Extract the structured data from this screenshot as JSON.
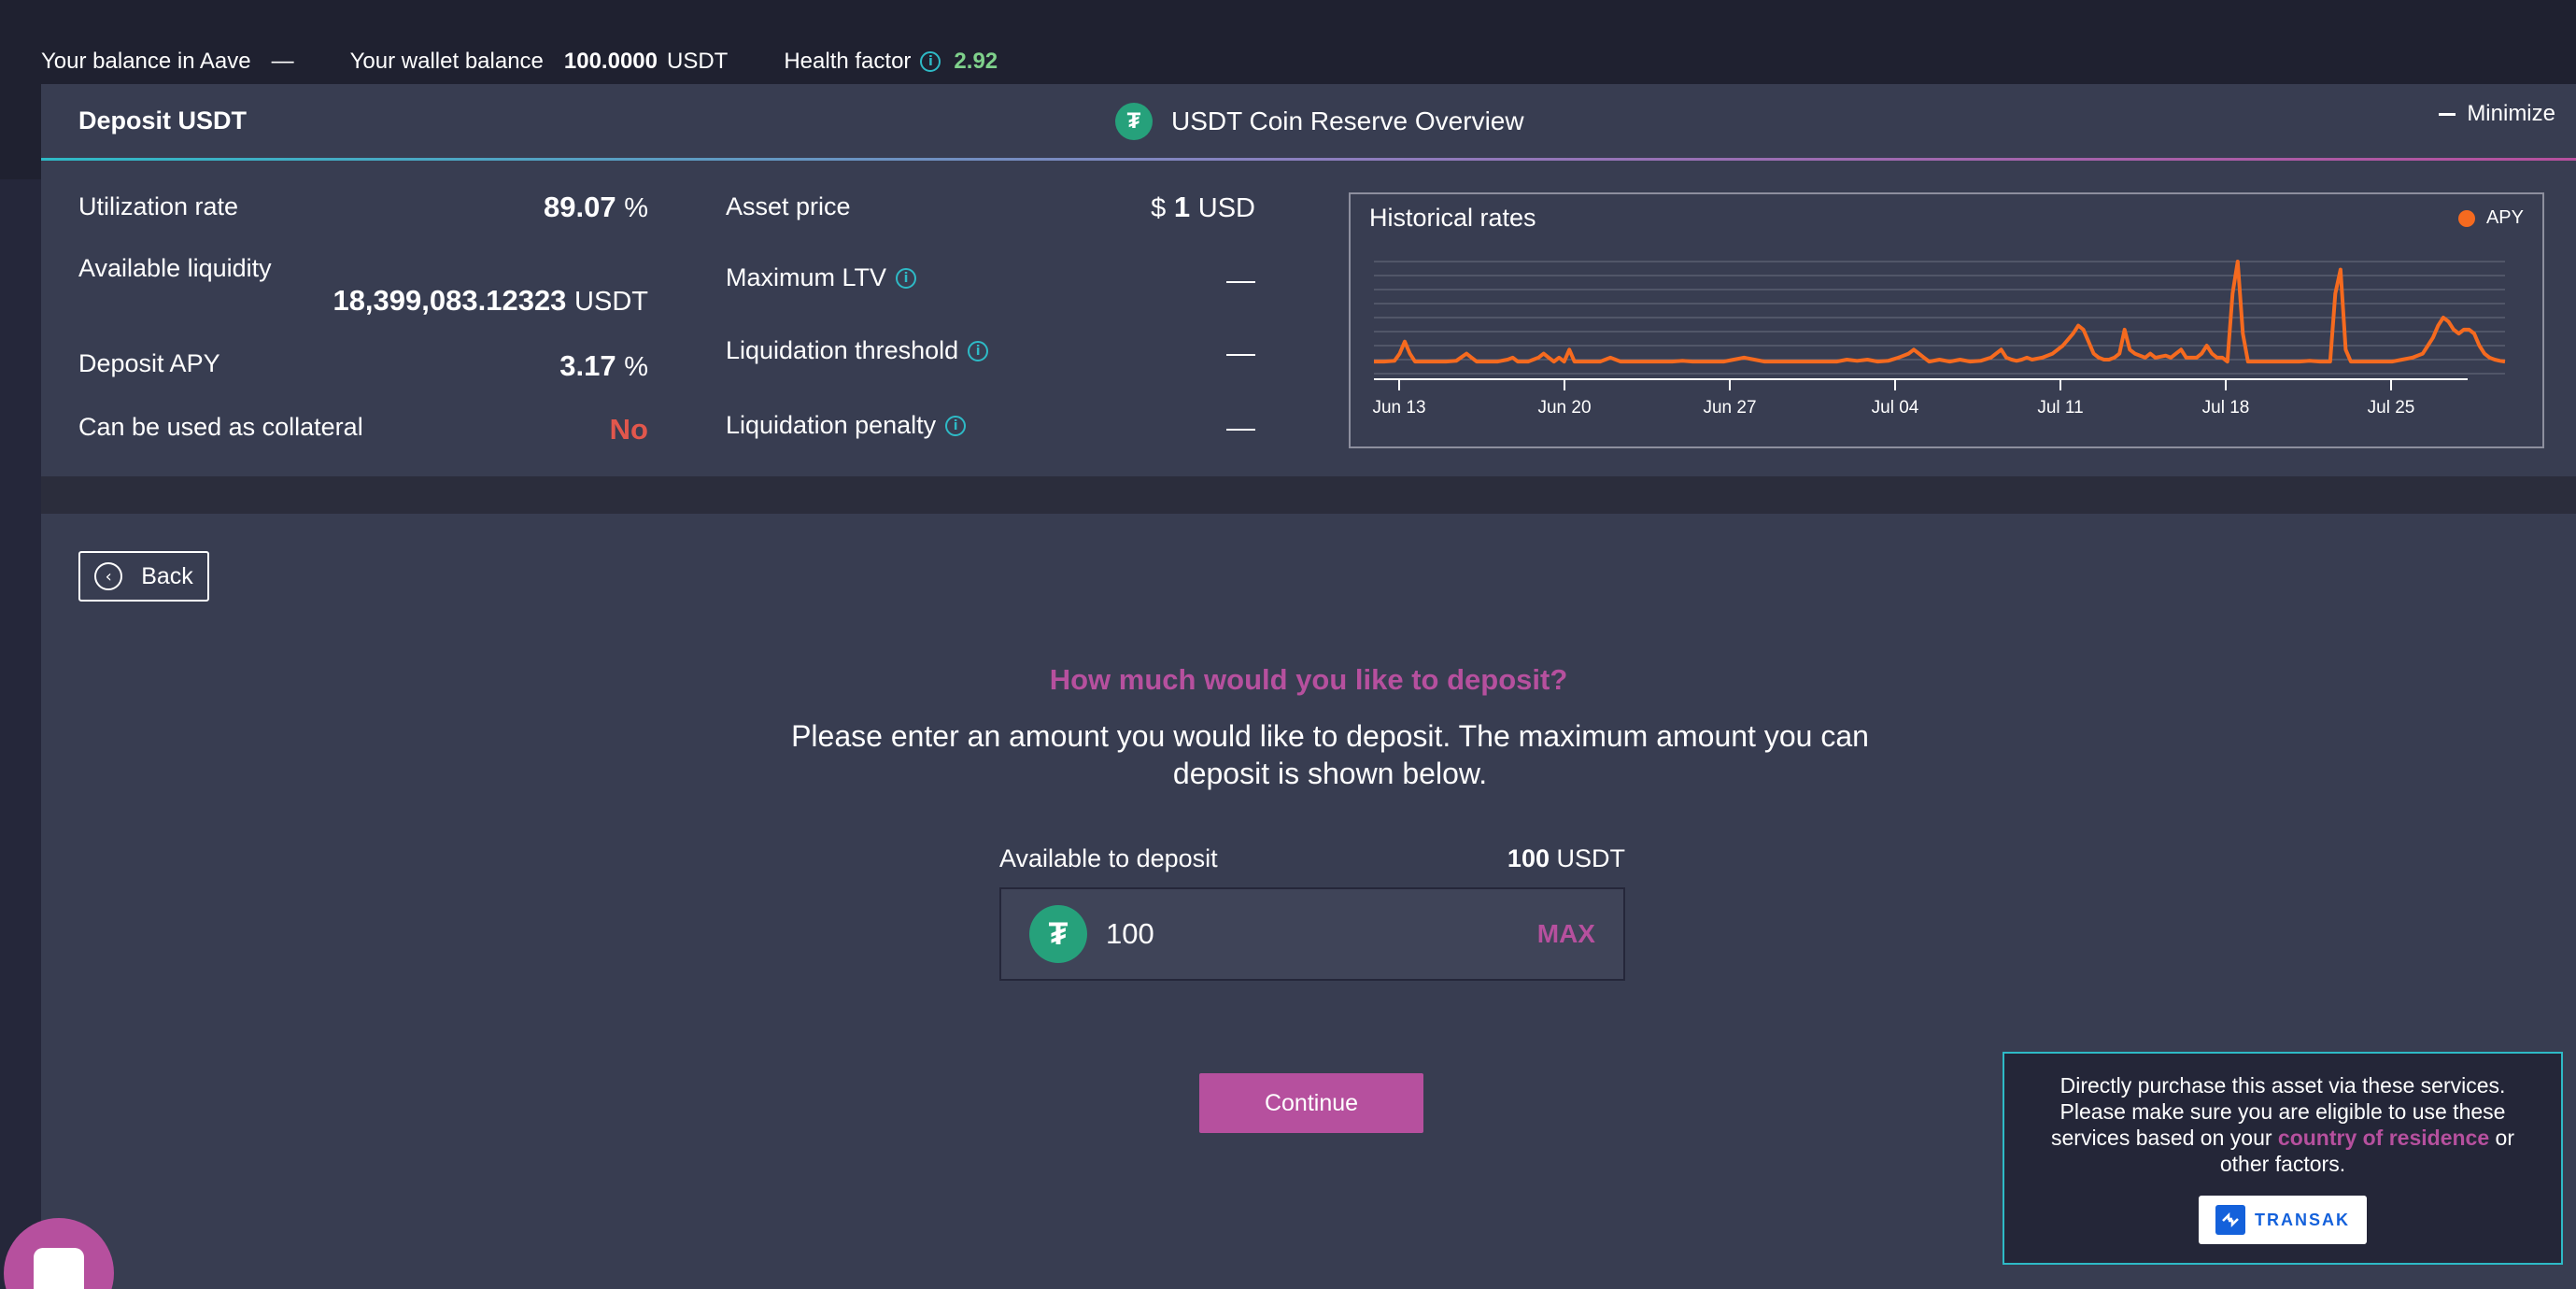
{
  "topbar": {
    "balance_aave_label": "Your balance in Aave",
    "balance_aave_value": "—",
    "wallet_label": "Your wallet balance",
    "wallet_value": "100.0000",
    "wallet_unit": "USDT",
    "health_label": "Health factor",
    "health_value": "2.92"
  },
  "overview": {
    "deposit_title": "Deposit USDT",
    "reserve_title": "USDT Coin Reserve Overview",
    "minimize_label": "Minimize",
    "stats_left": [
      {
        "label": "Utilization rate",
        "value": "89.07",
        "unit": "%"
      },
      {
        "label": "Available liquidity",
        "value": "18,399,083.12323",
        "unit": "USDT"
      },
      {
        "label": "Deposit APY",
        "value": "3.17",
        "unit": "%"
      },
      {
        "label": "Can be used as collateral",
        "value": "No"
      }
    ],
    "stats_mid": [
      {
        "label": "Asset price",
        "prefix": "$",
        "value": "1",
        "unit": "USD"
      },
      {
        "label": "Maximum LTV",
        "value": "—"
      },
      {
        "label": "Liquidation threshold",
        "value": "—"
      },
      {
        "label": "Liquidation penalty",
        "value": "—"
      }
    ]
  },
  "chart_data": {
    "type": "line",
    "title": "Historical rates",
    "legend": "APY",
    "legend_position": "top-right",
    "color": "#f56a1f",
    "grid": true,
    "x_ticks": [
      "Jun 13",
      "Jun 20",
      "Jun 27",
      "Jul 04",
      "Jul 11",
      "Jul 18",
      "Jul 25"
    ],
    "series": [
      {
        "name": "APY",
        "points": [
          [
            0,
            3
          ],
          [
            2,
            3
          ],
          [
            4,
            3.2
          ],
          [
            5,
            5
          ],
          [
            6,
            8
          ],
          [
            7,
            5
          ],
          [
            8,
            3
          ],
          [
            10,
            3
          ],
          [
            12,
            3
          ],
          [
            14,
            3
          ],
          [
            16,
            3.2
          ],
          [
            18,
            5
          ],
          [
            19,
            4
          ],
          [
            20,
            3
          ],
          [
            22,
            3
          ],
          [
            24,
            3
          ],
          [
            26,
            3.5
          ],
          [
            27,
            4
          ],
          [
            28,
            3
          ],
          [
            30,
            3
          ],
          [
            32,
            4
          ],
          [
            33,
            5
          ],
          [
            34,
            4
          ],
          [
            35,
            3
          ],
          [
            36,
            4
          ],
          [
            37,
            3
          ],
          [
            38,
            6
          ],
          [
            39,
            3
          ],
          [
            40,
            3
          ],
          [
            44,
            3
          ],
          [
            46,
            4
          ],
          [
            48,
            3
          ],
          [
            50,
            3
          ],
          [
            52,
            3
          ],
          [
            54,
            3
          ],
          [
            56,
            3
          ],
          [
            58,
            3
          ],
          [
            60,
            3.2
          ],
          [
            62,
            3
          ],
          [
            64,
            3
          ],
          [
            66,
            3
          ],
          [
            68,
            3
          ],
          [
            70,
            3.5
          ],
          [
            72,
            4
          ],
          [
            74,
            3.5
          ],
          [
            76,
            3
          ],
          [
            78,
            3
          ],
          [
            80,
            3
          ],
          [
            82,
            3
          ],
          [
            84,
            3
          ],
          [
            86,
            3
          ],
          [
            88,
            3
          ],
          [
            90,
            3
          ],
          [
            92,
            3.5
          ],
          [
            94,
            3.2
          ],
          [
            96,
            3.5
          ],
          [
            98,
            3
          ],
          [
            100,
            3.2
          ],
          [
            102,
            4
          ],
          [
            104,
            5
          ],
          [
            105,
            6
          ],
          [
            106,
            5
          ],
          [
            107,
            4
          ],
          [
            108,
            3
          ],
          [
            110,
            3.5
          ],
          [
            112,
            3
          ],
          [
            114,
            3.5
          ],
          [
            116,
            3
          ],
          [
            118,
            3.2
          ],
          [
            120,
            4
          ],
          [
            121,
            5
          ],
          [
            122,
            6
          ],
          [
            123,
            4
          ],
          [
            124,
            3.5
          ],
          [
            125,
            3.2
          ],
          [
            126,
            3.5
          ],
          [
            127,
            4
          ],
          [
            128,
            3.5
          ],
          [
            130,
            4
          ],
          [
            132,
            5
          ],
          [
            134,
            7
          ],
          [
            136,
            10
          ],
          [
            137,
            12
          ],
          [
            138,
            11
          ],
          [
            139,
            8
          ],
          [
            140,
            5
          ],
          [
            141,
            4
          ],
          [
            142,
            3.5
          ],
          [
            143,
            3.5
          ],
          [
            144,
            4
          ],
          [
            145,
            5
          ],
          [
            146,
            11
          ],
          [
            147,
            6
          ],
          [
            148,
            5
          ],
          [
            149,
            4.5
          ],
          [
            150,
            4
          ],
          [
            151,
            5
          ],
          [
            152,
            4
          ],
          [
            154,
            4.5
          ],
          [
            155,
            4
          ],
          [
            156,
            5
          ],
          [
            157,
            6
          ],
          [
            158,
            4
          ],
          [
            159,
            4
          ],
          [
            160,
            4
          ],
          [
            161,
            5
          ],
          [
            162,
            7
          ],
          [
            163,
            5
          ],
          [
            164,
            4
          ],
          [
            165,
            4
          ],
          [
            166,
            3
          ],
          [
            167,
            20
          ],
          [
            168,
            28
          ],
          [
            169,
            10
          ],
          [
            170,
            3
          ],
          [
            172,
            3
          ],
          [
            174,
            3
          ],
          [
            176,
            3
          ],
          [
            178,
            3
          ],
          [
            180,
            3
          ],
          [
            182,
            3.2
          ],
          [
            184,
            3
          ],
          [
            186,
            3
          ],
          [
            187,
            20
          ],
          [
            188,
            26
          ],
          [
            189,
            6
          ],
          [
            190,
            3
          ],
          [
            192,
            3
          ],
          [
            194,
            3
          ],
          [
            196,
            3
          ],
          [
            198,
            3
          ],
          [
            200,
            3.5
          ],
          [
            202,
            4
          ],
          [
            204,
            5
          ],
          [
            205,
            7
          ],
          [
            206,
            9
          ],
          [
            207,
            12
          ],
          [
            208,
            14
          ],
          [
            209,
            13
          ],
          [
            210,
            11
          ],
          [
            211,
            10
          ],
          [
            212,
            11
          ],
          [
            213,
            11
          ],
          [
            214,
            10
          ],
          [
            215,
            7
          ],
          [
            216,
            5
          ],
          [
            217,
            4
          ],
          [
            218,
            3.5
          ],
          [
            219,
            3.2
          ],
          [
            220,
            3
          ]
        ]
      }
    ]
  },
  "panel": {
    "back_label": "Back",
    "question": "How much would you like to deposit?",
    "description": "Please enter an amount you would like to deposit. The maximum amount you can deposit is shown below.",
    "available_label": "Available to deposit",
    "available_value": "100",
    "available_unit": "USDT",
    "amount_value": "100",
    "max_label": "MAX",
    "continue_label": "Continue"
  },
  "purchase": {
    "text_before": "Directly purchase this asset via these services. Please make sure you are eligible to use these services based on your",
    "link_text": "country of residence",
    "text_after": "or other factors.",
    "provider": "TRANSAK"
  },
  "colors": {
    "accent": "#b6509e",
    "teal": "#2ebac6",
    "chart_line": "#f56a1f",
    "health_green": "#7fd18b",
    "danger_red": "#e2574c"
  }
}
